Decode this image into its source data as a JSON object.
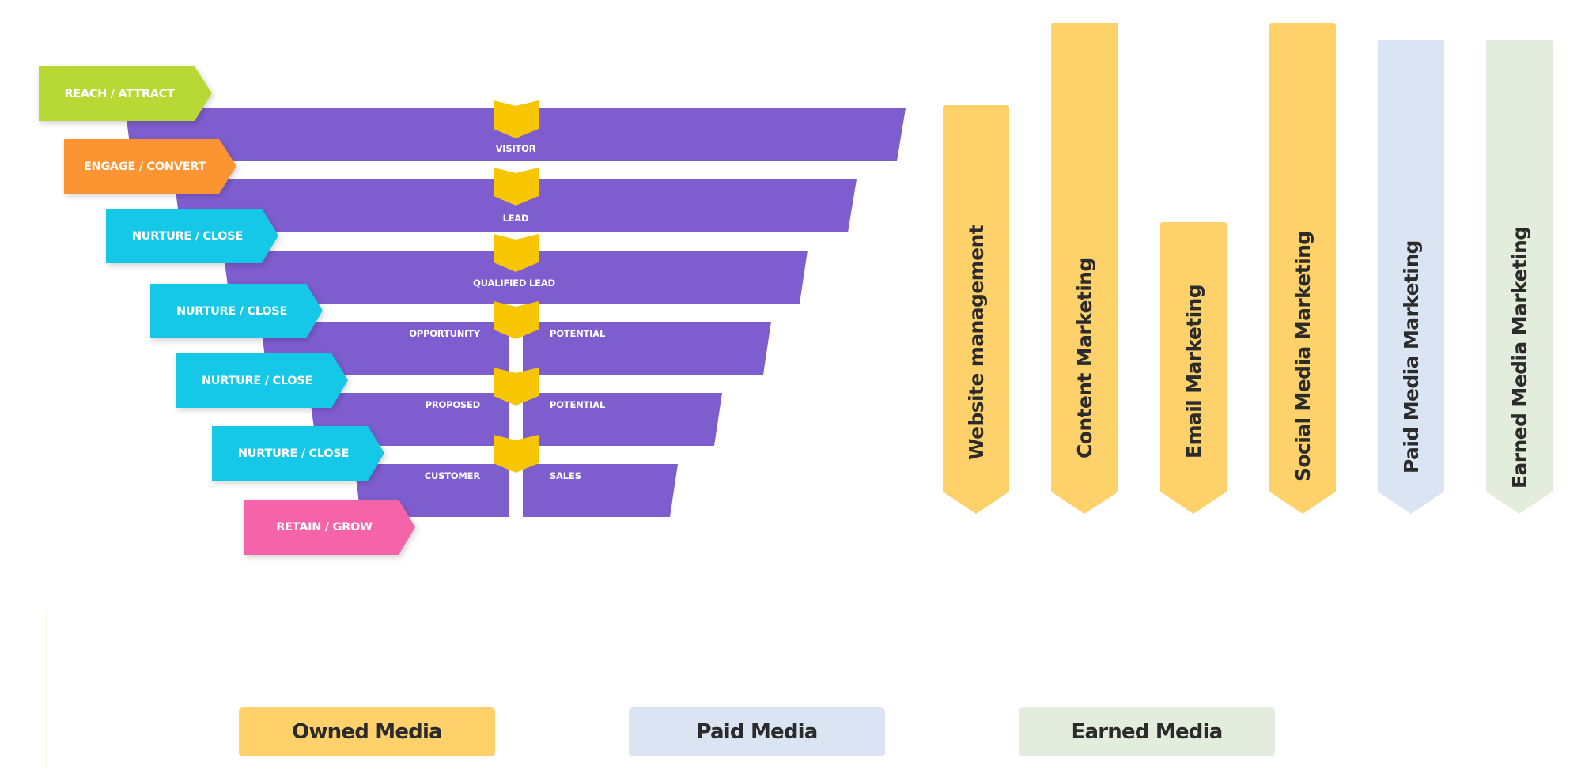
{
  "funnel": {
    "stage_color": "#7e5dcf",
    "chevron_color": "#f8c600",
    "stages": [
      {
        "label": "VISITOR"
      },
      {
        "label": "LEAD"
      },
      {
        "label": "QUALIFIED LEAD"
      },
      {
        "label": "OPPORTUNITY",
        "right_label": "POTENTIAL"
      },
      {
        "label": "PROPOSED",
        "right_label": "POTENTIAL"
      },
      {
        "label": "CUSTOMER",
        "right_label": "SALES"
      }
    ],
    "tags": [
      {
        "label": "REACH / ATTRACT",
        "color": "#b8d935"
      },
      {
        "label": "ENGAGE / CONVERT",
        "color": "#fd9433"
      },
      {
        "label": "NURTURE / CLOSE",
        "color": "#14c8e8"
      },
      {
        "label": "NURTURE / CLOSE",
        "color": "#14c8e8"
      },
      {
        "label": "NURTURE / CLOSE",
        "color": "#14c8e8"
      },
      {
        "label": "NURTURE / CLOSE",
        "color": "#14c8e8"
      },
      {
        "label": "RETAIN / GROW",
        "color": "#f563a8"
      }
    ]
  },
  "channels": [
    {
      "label": "Website management",
      "category": "owned"
    },
    {
      "label": "Content Marketing",
      "category": "owned"
    },
    {
      "label": "Email Marketing",
      "category": "owned"
    },
    {
      "label": "Social Media Marketing",
      "category": "owned"
    },
    {
      "label": "Paid Media Marketing",
      "category": "paid"
    },
    {
      "label": "Earned Media Marketing",
      "category": "earned"
    }
  ],
  "legend": [
    {
      "key": "owned",
      "label": "Owned Media",
      "color": "#fed16b"
    },
    {
      "key": "paid",
      "label": "Paid Media",
      "color": "#dbe4f2"
    },
    {
      "key": "earned",
      "label": "Earned Media",
      "color": "#e3edde"
    }
  ]
}
